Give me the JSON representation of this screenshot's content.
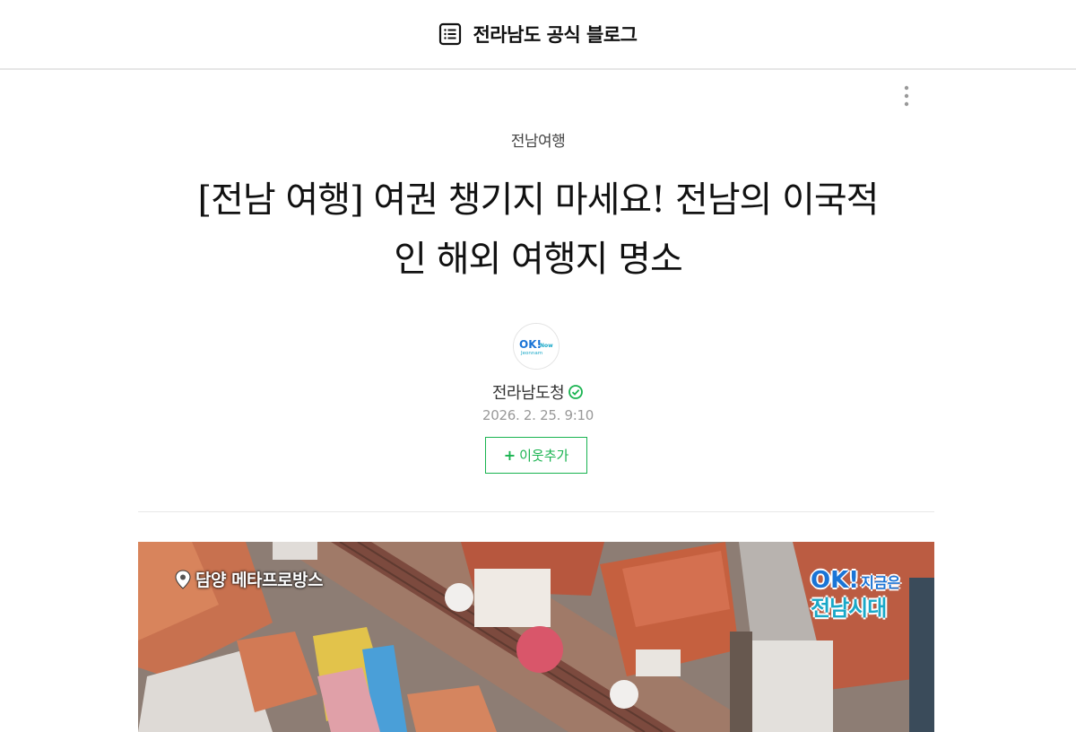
{
  "header": {
    "blog_title": "전라남도 공식 블로그",
    "icon": "list-icon"
  },
  "post": {
    "category": "전남여행",
    "title_line1": "[전남 여행] 여권 챙기지 마세요! 전남의 이국적",
    "title_line2": "인 해외 여행지 명소",
    "more_icon": "more-vertical-icon"
  },
  "author": {
    "name": "전라남도청",
    "avatar_text_top": "OK!",
    "avatar_text_side": "Now",
    "avatar_text_bottom": "Jeonnam",
    "verified_icon": "verified-check-icon",
    "date": "2026. 2. 25. 9:10",
    "follow_plus": "+",
    "follow_label": "이웃추가"
  },
  "hero": {
    "location_label": "담양 메타프로방스",
    "location_icon": "map-pin-icon",
    "logo_ok": "OK!",
    "logo_sub": "지금은",
    "logo_main": "전남시대"
  },
  "colors": {
    "accent_green": "#19b350",
    "logo_blue": "#1a74d6",
    "logo_cyan": "#19a8c8"
  }
}
